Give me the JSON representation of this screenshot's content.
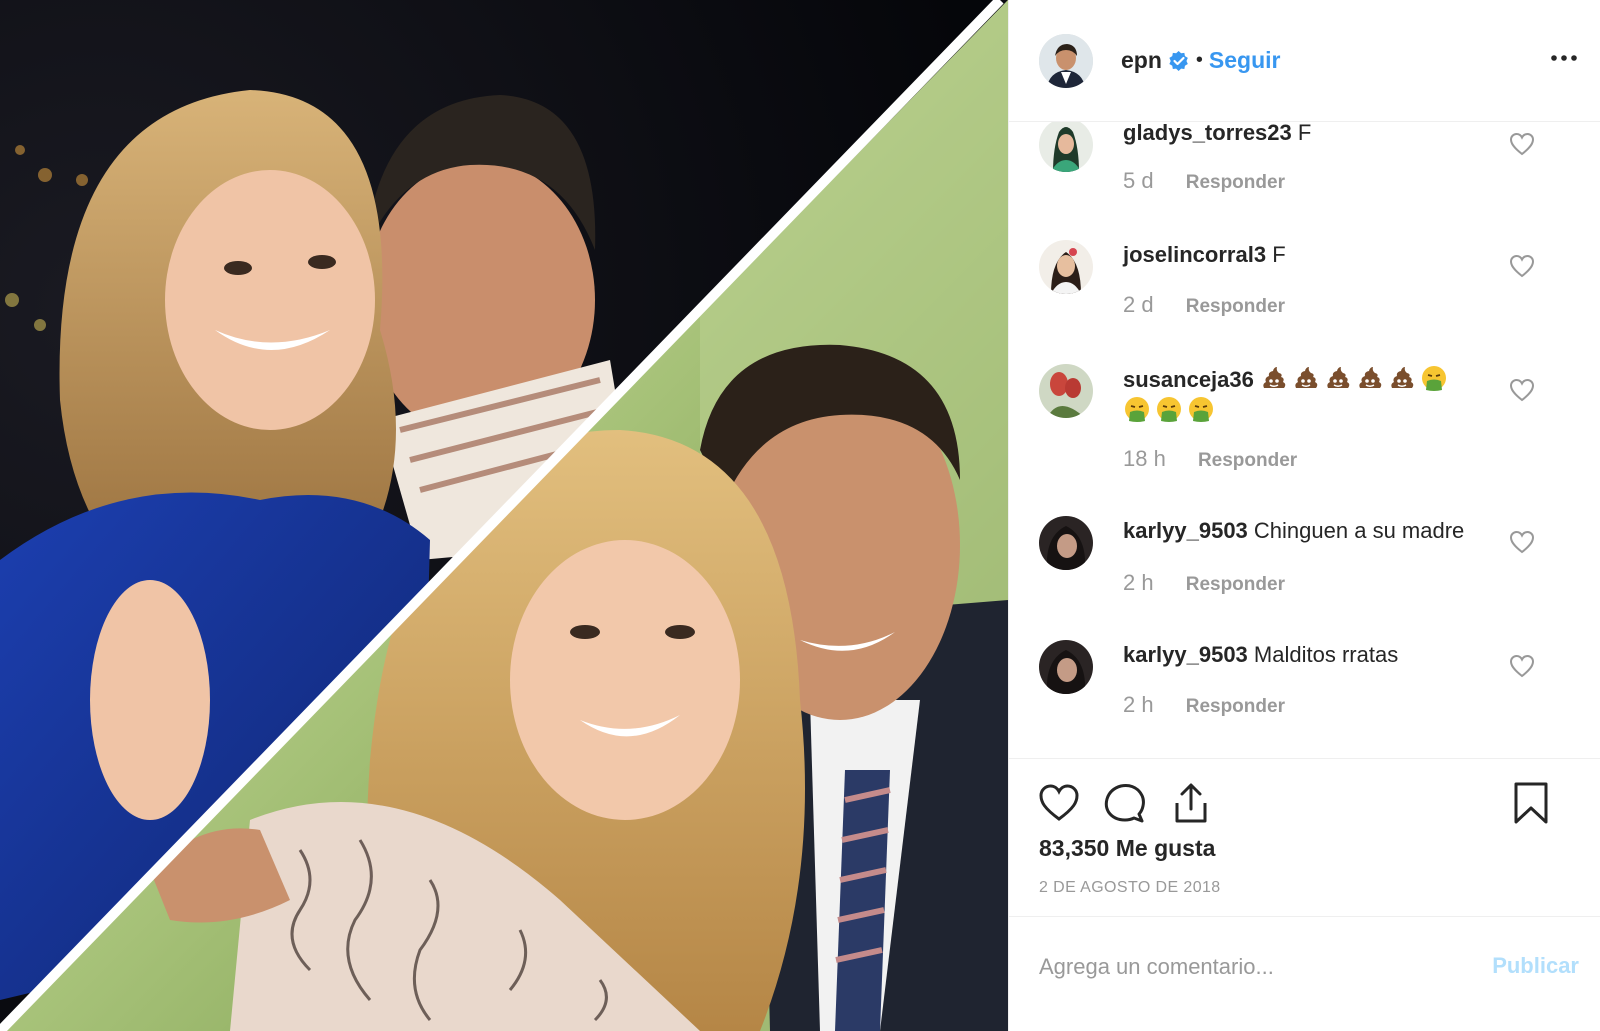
{
  "post": {
    "username": "epn",
    "follow_label": "Seguir",
    "separator": "•"
  },
  "comments": [
    {
      "user": "gladys_torres23",
      "text": "F",
      "time": "5 d",
      "reply_label": "Responder"
    },
    {
      "user": "joselincorral3",
      "text": "F",
      "time": "2 d",
      "reply_label": "Responder"
    },
    {
      "user": "susanceja36",
      "text": "💩💩💩💩💩🤮🤮🤮🤮",
      "time": "18 h",
      "reply_label": "Responder"
    },
    {
      "user": "karlyy_9503",
      "text": "Chinguen a su madre",
      "time": "2 h",
      "reply_label": "Responder"
    },
    {
      "user": "karlyy_9503",
      "text": "Malditos rratas",
      "time": "2 h",
      "reply_label": "Responder"
    }
  ],
  "actions": {
    "likes": "83,350 Me gusta",
    "date": "2 DE AGOSTO DE 2018"
  },
  "add_comment": {
    "placeholder": "Agrega un comentario...",
    "publish_label": "Publicar"
  },
  "colors": {
    "link": "#3897f0",
    "muted": "#999999",
    "publish_disabled": "#b2dffc",
    "verified": "#3897f0"
  },
  "icons": [
    "verified-icon",
    "more-options-icon",
    "heart-icon",
    "comment-icon",
    "share-icon",
    "bookmark-icon",
    "poop-emoji",
    "vomit-emoji"
  ]
}
